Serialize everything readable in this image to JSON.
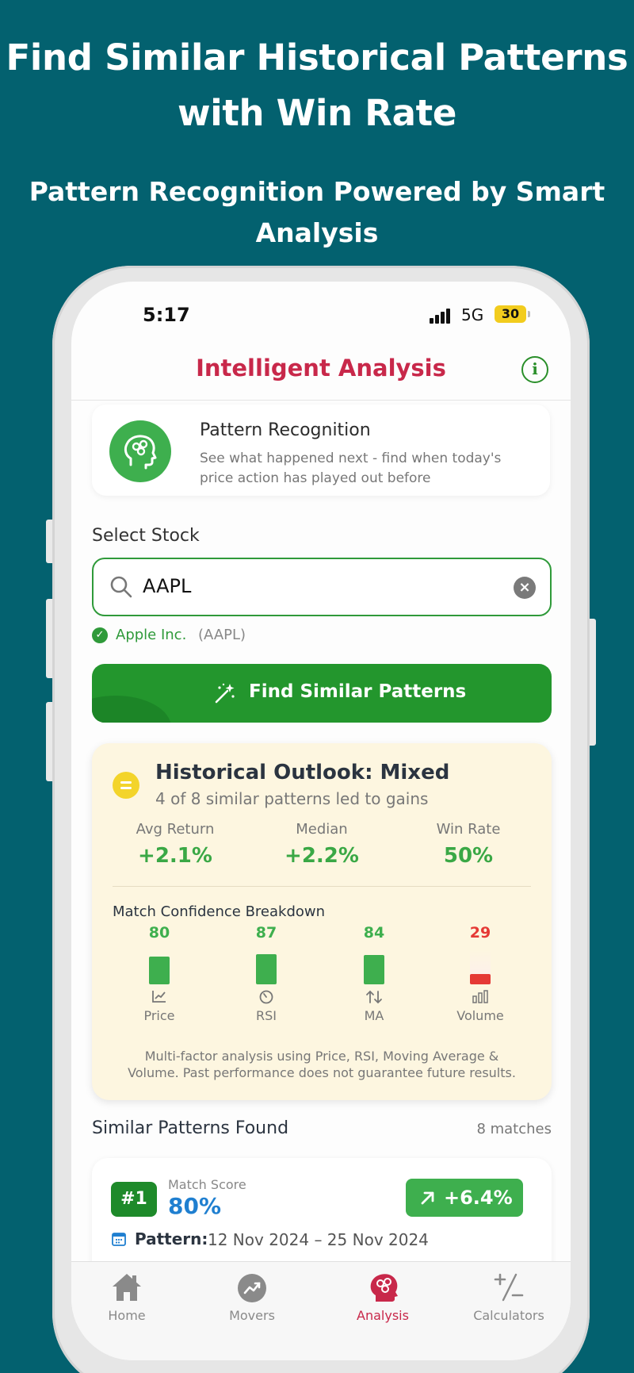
{
  "promo": {
    "headline_line1": "Find Similar Historical Patterns",
    "headline_line2": "with Win Rate",
    "subheadline_line1": "Pattern Recognition Powered by Smart",
    "subheadline_line2": "Analysis"
  },
  "status_bar": {
    "time": "5:17",
    "network": "5G",
    "battery": "30"
  },
  "header": {
    "title": "Intelligent Analysis",
    "info_icon": "info-icon"
  },
  "pattern_card": {
    "title": "Pattern Recognition",
    "description": "See what happened next - find when today's price action has played out before",
    "icon": "brain-head-icon"
  },
  "stock_select": {
    "label": "Select Stock",
    "search_value": "AAPL",
    "validated_name": "Apple Inc.",
    "validated_ticker": "(AAPL)"
  },
  "find_button": {
    "label": "Find Similar Patterns",
    "icon": "magic-wand-icon"
  },
  "outlook": {
    "title": "Historical Outlook: Mixed",
    "subtitle": "4 of 8 similar patterns led to gains",
    "stats": [
      {
        "label": "Avg Return",
        "value": "+2.1%"
      },
      {
        "label": "Median",
        "value": "+2.2%"
      },
      {
        "label": "Win Rate",
        "value": "50%"
      }
    ],
    "breakdown_title": "Match Confidence Breakdown",
    "factors": [
      {
        "label": "Price",
        "score": "80",
        "level": 0.8,
        "color": "#3eaf4e",
        "icon": "chart-line-icon"
      },
      {
        "label": "RSI",
        "score": "87",
        "level": 0.87,
        "color": "#3eaf4e",
        "icon": "gauge-icon"
      },
      {
        "label": "MA",
        "score": "84",
        "level": 0.84,
        "color": "#3eaf4e",
        "icon": "arrows-updown-icon"
      },
      {
        "label": "Volume",
        "score": "29",
        "level": 0.29,
        "color": "#e53935",
        "icon": "bar-chart-icon"
      }
    ],
    "disclaimer_line1": "Multi-factor analysis using Price, RSI, Moving Average &",
    "disclaimer_line2": "Volume. Past performance does not guarantee future results."
  },
  "similar_patterns": {
    "title": "Similar Patterns Found",
    "count": "8 matches",
    "matches": [
      {
        "rank": "#1",
        "score_label": "Match Score",
        "score": "80%",
        "return": "+6.4%",
        "pattern_label": "Pattern:",
        "pattern_dates": "12 Nov 2024 – 25 Nov 2024"
      }
    ]
  },
  "tabs": [
    {
      "label": "Home",
      "icon": "home-icon",
      "active": false
    },
    {
      "label": "Movers",
      "icon": "trending-icon",
      "active": false
    },
    {
      "label": "Analysis",
      "icon": "brain-icon",
      "active": true
    },
    {
      "label": "Calculators",
      "icon": "calculator-icon",
      "active": false
    }
  ],
  "colors": {
    "background": "#03616f",
    "accent_red": "#c8284a",
    "accent_green": "#23962d",
    "score_blue": "#1f7fd0"
  }
}
